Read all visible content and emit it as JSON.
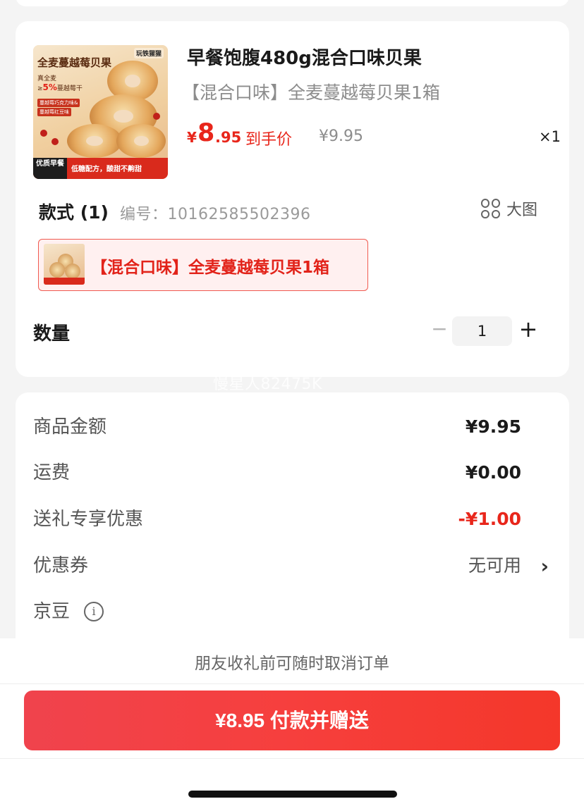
{
  "product": {
    "thumb_title": "全麦蔓越莓贝果",
    "thumb_brand": "玩铁猩猩",
    "thumb_sub1": "真全麦",
    "thumb_sub2_prefix": "≥",
    "thumb_sub2_num": "5%",
    "thumb_sub2_suffix": "蔓越莓干",
    "thumb_tag1": "蔓越莓巧克力味&",
    "thumb_tag2": "蔓越莓红豆味",
    "thumb_badge_left": "优质早餐",
    "thumb_badge_right": "低糖配方，酸甜不齁甜",
    "title": "早餐饱腹480g混合口味贝果",
    "subtitle": "【混合口味】全麦蔓越莓贝果1箱",
    "price_currency": "¥",
    "price_int": "8",
    "price_dec": ".95",
    "price_label": "到手价",
    "original_price": "¥9.95",
    "quantity_mark": "×1"
  },
  "style": {
    "label": "款式 (1)",
    "code": "编号：10162585502396",
    "big_image": "大图",
    "chip_text": "【混合口味】全麦蔓越莓贝果1箱"
  },
  "quantity": {
    "label": "数量",
    "minus": "−",
    "value": "1",
    "plus": "+"
  },
  "watermark": "慢星人82475K",
  "summary": {
    "rows": [
      {
        "label": "商品金额",
        "value": "¥9.95"
      },
      {
        "label": "运费",
        "value": "¥0.00"
      },
      {
        "label": "送礼专享优惠",
        "value": "-¥1.00"
      },
      {
        "label": "优惠券",
        "value": "无可用"
      },
      {
        "label": "京豆",
        "value": ""
      }
    ],
    "info_glyph": "i",
    "chevron": "›"
  },
  "footer": {
    "notice": "朋友收礼前可随时取消订单",
    "pay_button": "¥8.95 付款并赠送"
  },
  "colors": {
    "accent_red": "#e8261b",
    "button_red": "#f63f3d"
  }
}
